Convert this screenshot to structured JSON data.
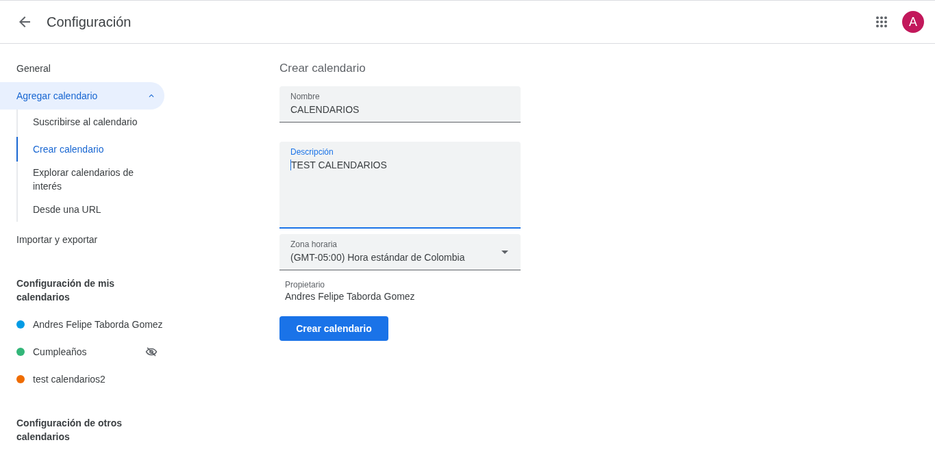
{
  "header": {
    "title": "Configuración",
    "avatar": "A"
  },
  "sidebar": {
    "items": [
      {
        "label": "General",
        "selected": false
      },
      {
        "label": "Agregar calendario",
        "selected": true,
        "expanded": true,
        "children": [
          {
            "label": "Suscribirse al calendario",
            "selected": false
          },
          {
            "label": "Crear calendario",
            "selected": true
          },
          {
            "label": "Explorar calendarios de interés",
            "selected": false
          },
          {
            "label": "Desde una URL",
            "selected": false
          }
        ]
      },
      {
        "label": "Importar y exportar",
        "selected": false
      }
    ],
    "sections": [
      {
        "title": "Configuración de mis calendarios",
        "calendars": [
          {
            "name": "Andres Felipe Taborda Gomez",
            "color": "#039be5",
            "hidden": false
          },
          {
            "name": "Cumpleaños",
            "color": "#33b679",
            "hidden": true
          },
          {
            "name": "test calendarios2",
            "color": "#ef6c00",
            "hidden": false
          }
        ]
      },
      {
        "title": "Configuración de otros calendarios"
      }
    ]
  },
  "form": {
    "title": "Crear calendario",
    "fields": [
      {
        "kind": "text",
        "label": "Nombre",
        "value": "CALENDARIOS",
        "focused": false
      },
      {
        "kind": "textarea",
        "label": "Descripción",
        "value": "TEST CALENDARIOS",
        "focused": true
      },
      {
        "kind": "select",
        "label": "Zona horaria",
        "value": "(GMT-05:00) Hora estándar de Colombia",
        "focused": false
      }
    ],
    "owner": {
      "label": "Propietario",
      "value": "Andres Felipe Taborda Gomez"
    },
    "button": "Crear calendario"
  }
}
